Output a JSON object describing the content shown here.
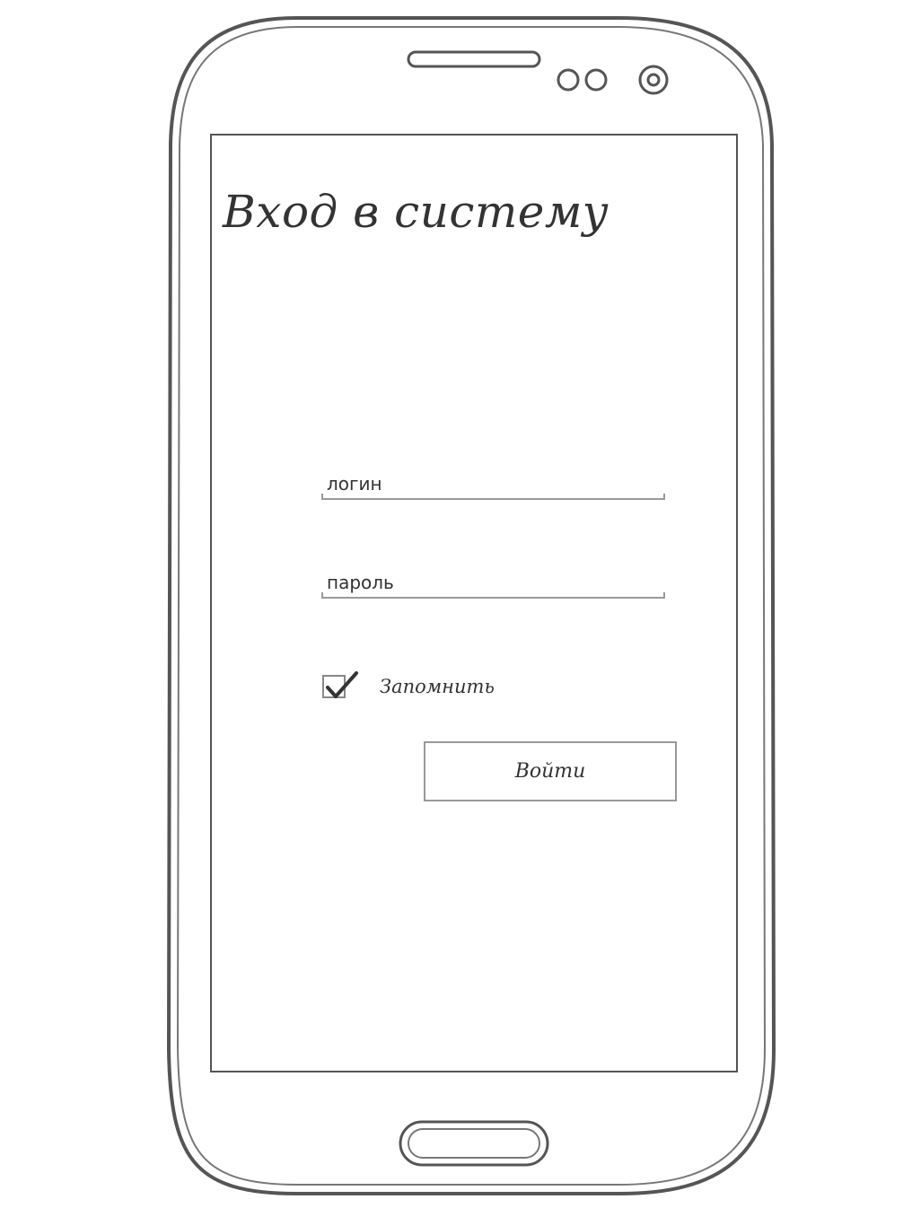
{
  "screen": {
    "title": "Вход в систему"
  },
  "form": {
    "login_placeholder": "логин",
    "password_placeholder": "пароль",
    "remember_label": "Запомнить",
    "remember_checked": true,
    "submit_label": "Войти"
  },
  "device": {
    "earpiece_icon": "speaker-slot-icon",
    "sensor_icons": "sensor-dots-icon",
    "camera_icon": "camera-icon",
    "home_button_icon": "home-button-icon"
  },
  "colors": {
    "outline": "#555555",
    "text": "#333333",
    "field_line": "#999999"
  }
}
